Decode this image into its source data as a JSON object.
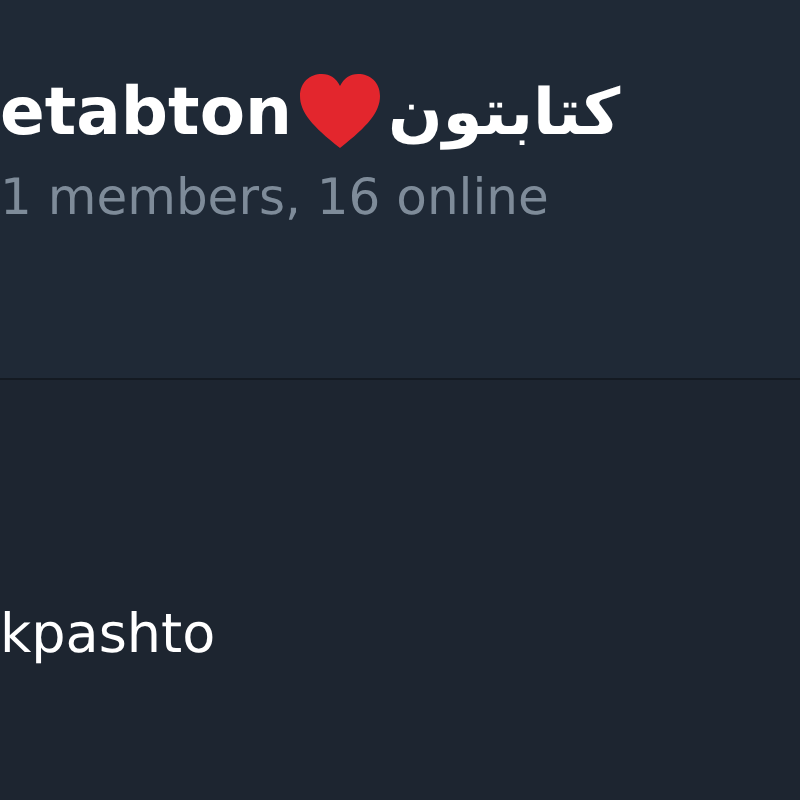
{
  "header": {
    "title_latin": "etabton",
    "title_persian": "کتابتون",
    "subtitle": "1 members, 16 online"
  },
  "content": {
    "text": "kpashto"
  }
}
